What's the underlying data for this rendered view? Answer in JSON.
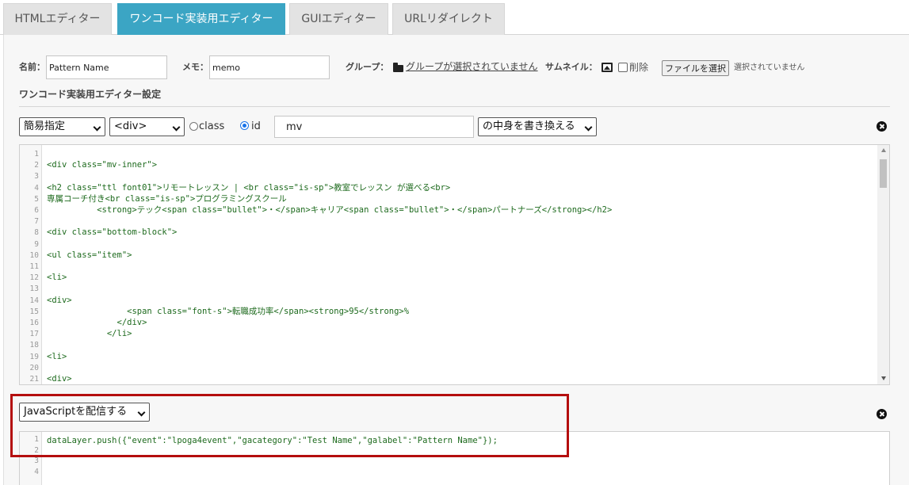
{
  "tabs": [
    {
      "label": "HTMLエディター",
      "active": false
    },
    {
      "label": "ワンコード実装用エディター",
      "active": true
    },
    {
      "label": "GUIエディター",
      "active": false
    },
    {
      "label": "URLリダイレクト",
      "active": false
    }
  ],
  "form": {
    "name_label": "名前：",
    "name_value": "Pattern Name",
    "memo_label": "メモ：",
    "memo_value": "memo",
    "group_label": "グループ：",
    "group_link": "グループが選択されていません",
    "thumbnail_label": "サムネイル：",
    "delete_label": "削除",
    "file_button": "ファイルを選択",
    "file_status": "選択されていません"
  },
  "section_title": "ワンコード実装用エディター設定",
  "selector": {
    "mode": "簡易指定",
    "tag": "<div>",
    "class_label": "class",
    "id_label": "id",
    "selected": "id",
    "id_value": "mv",
    "action": "の中身を書き換える"
  },
  "html_editor": {
    "line_numbers": [
      "1",
      "2",
      "3",
      "4",
      "5",
      "6",
      "7",
      "8",
      "9",
      "10",
      "11",
      "12",
      "13",
      "14",
      "15",
      "16",
      "17",
      "18",
      "19",
      "20",
      "21"
    ],
    "lines": [
      {
        "n": 2,
        "text": "<div class=\"mv-inner\">"
      },
      {
        "n": 4,
        "text": "<h2 class=\"ttl font01\">リモートレッスン | <br class=\"is-sp\">教室でレッスン が選べる<br>"
      },
      {
        "n": 5,
        "text": "専属コーチ付き<br class=\"is-sp\">プログラミングスクール"
      },
      {
        "n": 6,
        "text": "          <strong>テック<span class=\"bullet\">・</span>キャリア<span class=\"bullet\">・</span>パートナーズ</strong></h2>"
      },
      {
        "n": 8,
        "text": "<div class=\"bottom-block\">"
      },
      {
        "n": 10,
        "text": "<ul class=\"item\">"
      },
      {
        "n": 12,
        "text": "<li>"
      },
      {
        "n": 14,
        "text": "<div>"
      },
      {
        "n": 15,
        "text": "                <span class=\"font-s\">転職成功率</span><strong>95</strong>%"
      },
      {
        "n": 16,
        "text": "              </div>"
      },
      {
        "n": 17,
        "text": "            </li>"
      },
      {
        "n": 19,
        "text": "<li>"
      },
      {
        "n": 21,
        "text": "<div>"
      }
    ]
  },
  "js_section": {
    "mode": "JavaScriptを配信する",
    "line_numbers": [
      "1",
      "2",
      "3",
      "4"
    ],
    "code": "dataLayer.push({\"event\":\"lpoga4event\",\"gacategory\":\"Test Name\",\"galabel\":\"Pattern Name\"});"
  },
  "colors": {
    "active_tab": "#3ba5c4",
    "highlight_border": "#b40e0e",
    "code_text": "#1d6a1d"
  }
}
